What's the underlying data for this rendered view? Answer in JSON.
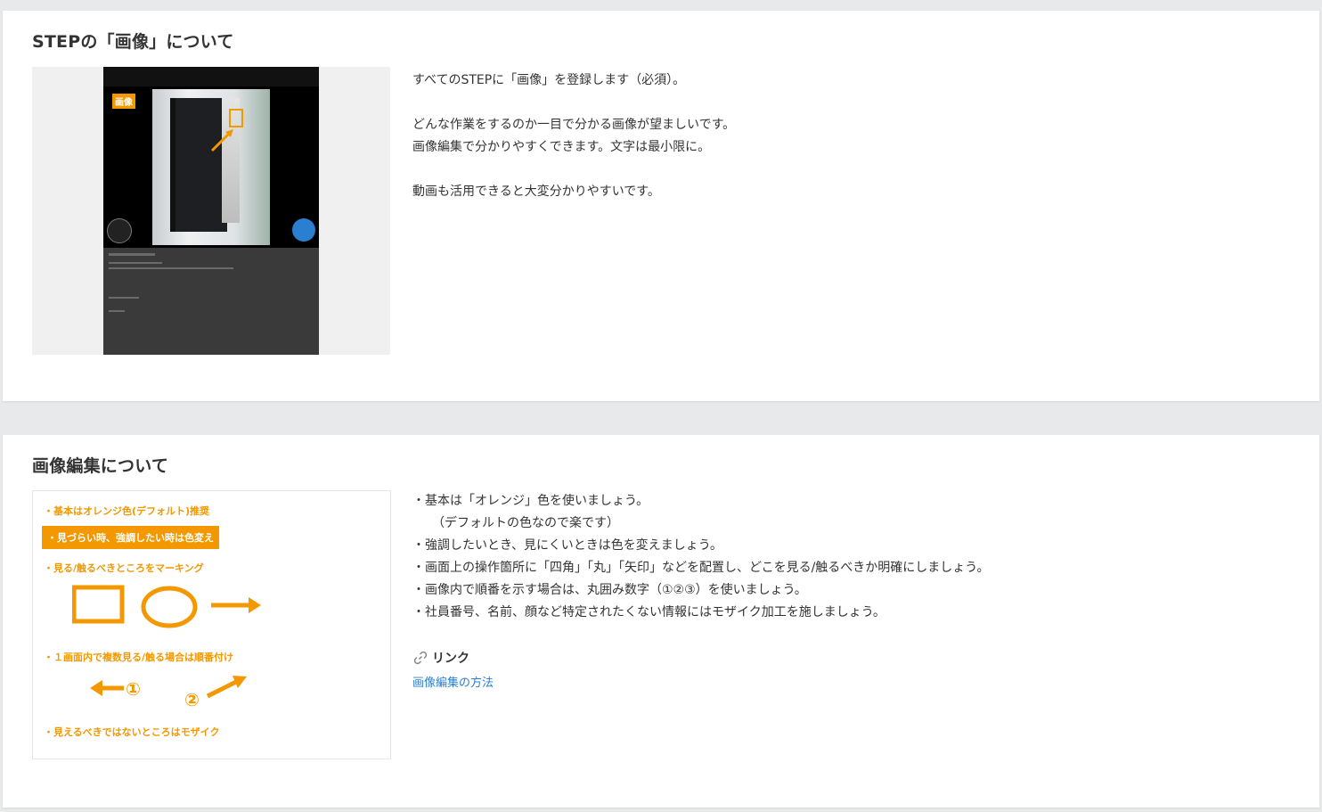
{
  "section1": {
    "title": "STEPの「画像」について",
    "thumbnail": {
      "label": "画像"
    },
    "description": [
      "すべてのSTEPに「画像」を登録します（必須）。",
      "",
      "どんな作業をするのか一目で分かる画像が望ましいです。",
      "画像編集で分かりやすくできます。文字は最小限に。",
      "",
      "動画も活用できると大変分かりやすいです。"
    ]
  },
  "section2": {
    "title": "画像編集について",
    "guide": {
      "line1": "・基本はオレンジ色(デフォルト)推奨",
      "line2": "・見づらい時、強調したい時は色変え",
      "line3": "・見る/触るべきところをマーキング",
      "line4": "・１画面内で複数見る/触る場合は順番付け",
      "num1": "①",
      "num2": "②",
      "line5": "・見えるべきではないところはモザイク"
    },
    "description": [
      "・基本は「オレンジ」色を使いましょう。",
      "（デフォルトの色なので楽です）",
      "・強調したいとき、見にくいときは色を変えましょう。",
      "・画面上の操作箇所に「四角」「丸」「矢印」などを配置し、どこを見る/触るべきか明確にしましょう。",
      "・画像内で順番を示す場合は、丸囲み数字（①②③）を使いましょう。",
      "・社員番号、名前、顔など特定されたくない情報にはモザイク加工を施しましょう。"
    ],
    "link": {
      "heading": "リンク",
      "text": "画像編集の方法",
      "icon": "link-icon"
    }
  },
  "colors": {
    "accent": "#f39800",
    "link": "#2a7fd0"
  }
}
